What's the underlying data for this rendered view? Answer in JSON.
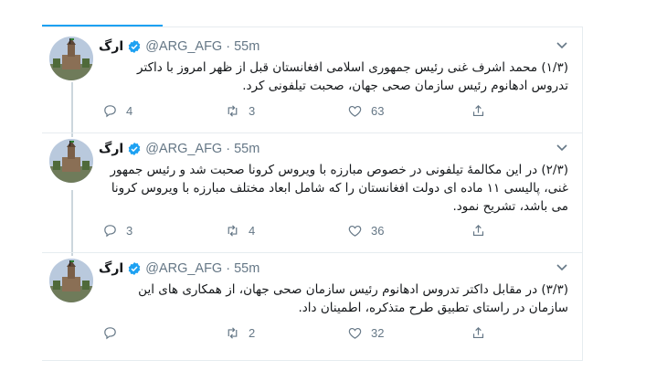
{
  "tweets": [
    {
      "name": "ارگ",
      "handle": "@ARG_AFG",
      "dot": "·",
      "time": "55m",
      "text": "(۱/۳) محمد اشرف غنی رئیس جمهوری اسلامی افغانستان قبل از ظهر امروز با داکتر تدروس ادهانوم رئیس سازمان صحی جهان، صحبت تیلفونی کرد.",
      "replies": "4",
      "retweets": "3",
      "likes": "63"
    },
    {
      "name": "ارگ",
      "handle": "@ARG_AFG",
      "dot": "·",
      "time": "55m",
      "text": "(۲/۳) در این مکالمهٔ تیلفونی در خصوص مبارزه با ویروس کرونا صحبت شد و رئیس جمهور غنی، پالیسی ۱۱ ماده ای دولت افغانستان را که شامل ابعاد مختلف مبارزه با ویروس کرونا می باشد، تشریح نمود.",
      "replies": "3",
      "retweets": "4",
      "likes": "36"
    },
    {
      "name": "ارگ",
      "handle": "@ARG_AFG",
      "dot": "·",
      "time": "55m",
      "text": "(۳/۳) در مقابل داکتر تدروس ادهانوم رئیس سازمان صحی جهان، از همکاری های این سازمان در راستای تطبیق طرح متذکره، اطمینان داد.",
      "replies": "",
      "retweets": "2",
      "likes": "32"
    }
  ],
  "icons": {
    "verified": "verified-badge-icon",
    "caret": "chevron-down-icon",
    "reply": "reply-icon",
    "retweet": "retweet-icon",
    "like": "heart-icon",
    "share": "share-icon"
  },
  "colors": {
    "accent": "#1da1f2",
    "muted": "#657786",
    "border": "#e6ecf0"
  }
}
